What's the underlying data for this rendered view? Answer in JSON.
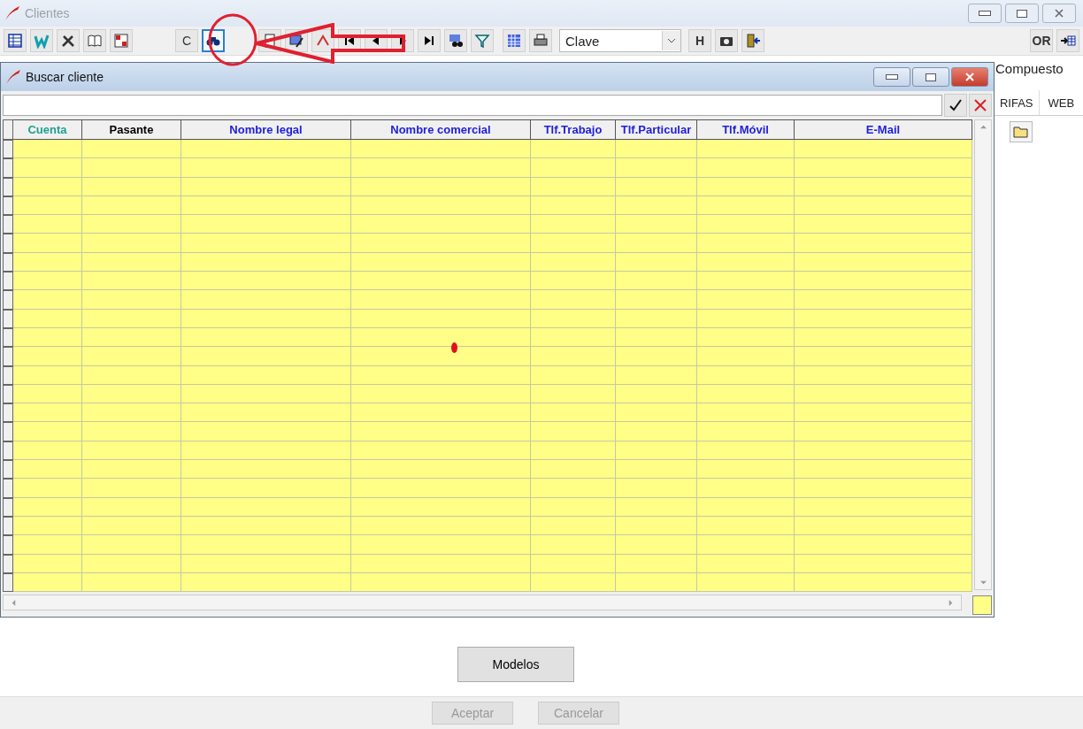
{
  "window": {
    "title": "Clientes"
  },
  "toolbar": {
    "letter_buttons": [
      "C",
      "H",
      "OR"
    ],
    "find_button": {
      "selected": true
    },
    "sort_dropdown": {
      "value": "Clave"
    }
  },
  "background": {
    "label": "Compuesto",
    "tabs": [
      {
        "label": "RIFAS",
        "selected": false
      },
      {
        "label": "WEB",
        "selected": false
      }
    ],
    "models_button": "Modelos"
  },
  "footer": {
    "buttons": [
      {
        "label": "Aceptar",
        "disabled": true
      },
      {
        "label": "Cancelar",
        "disabled": true
      }
    ]
  },
  "dialog": {
    "title": "Buscar cliente",
    "table": {
      "columns": [
        {
          "label": "Cuenta",
          "color": "#20a090"
        },
        {
          "label": "Pasante",
          "color": "#000000"
        },
        {
          "label": "Nombre legal",
          "color": "#2020e0"
        },
        {
          "label": "Nombre comercial",
          "color": "#2020e0"
        },
        {
          "label": "Tlf.Trabajo",
          "color": "#2020e0"
        },
        {
          "label": "Tlf.Particular",
          "color": "#2020e0"
        },
        {
          "label": "Tlf.Móvil",
          "color": "#2020e0"
        },
        {
          "label": "E-Mail",
          "color": "#2020e0"
        }
      ]
    }
  }
}
